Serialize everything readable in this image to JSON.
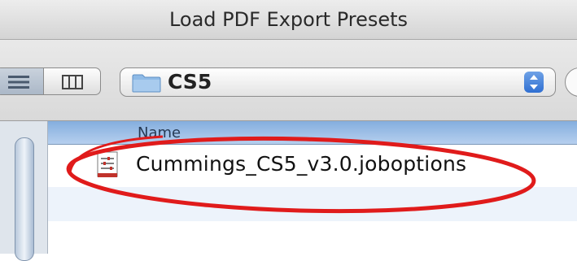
{
  "dialog": {
    "title": "Load PDF Export Presets"
  },
  "toolbar": {
    "view_list_icon": "list-view-icon",
    "view_columns_icon": "column-view-icon",
    "location": {
      "value": "CS5",
      "icon": "folder-icon"
    }
  },
  "browser": {
    "column_header": "Name",
    "files": [
      {
        "name": "Cummings_CS5_v3.0.joboptions",
        "icon": "joboptions-file-icon"
      }
    ]
  },
  "annotation": {
    "type": "ellipse",
    "color": "#e01b1b"
  },
  "colors": {
    "header_blue": "#84aede",
    "selection_accent": "#2f6fd2"
  }
}
